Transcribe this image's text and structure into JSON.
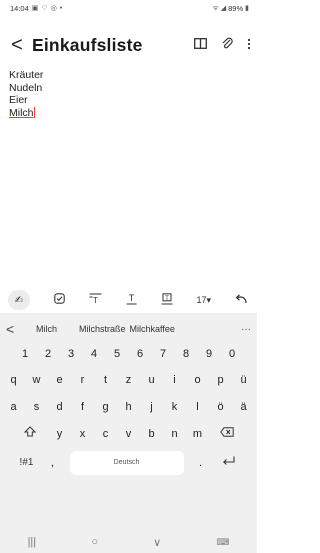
{
  "status": {
    "time": "14:04",
    "left_icons": [
      "gallery-icon",
      "alarm-icon",
      "location-icon",
      "dot-icon"
    ],
    "battery": "89%"
  },
  "app": {
    "back": "<",
    "title": "Einkaufsliste",
    "actions": [
      "book-icon",
      "attach-icon",
      "more-icon"
    ]
  },
  "note": {
    "lines": [
      "Kräuter",
      "Nudeln",
      "Eier",
      "Milch"
    ]
  },
  "toolbar": {
    "font_size": "17▾"
  },
  "suggestions": {
    "items": [
      "Milch",
      "Milchstraße",
      "Milchkaffee"
    ],
    "more": "···"
  },
  "keyboard": {
    "row1": [
      "1",
      "2",
      "3",
      "4",
      "5",
      "6",
      "7",
      "8",
      "9",
      "0"
    ],
    "row2": [
      "q",
      "w",
      "e",
      "r",
      "t",
      "z",
      "u",
      "i",
      "o",
      "p",
      "ü"
    ],
    "row3": [
      "a",
      "s",
      "d",
      "f",
      "g",
      "h",
      "j",
      "k",
      "l",
      "ö",
      "ä"
    ],
    "row4": [
      "y",
      "x",
      "c",
      "v",
      "b",
      "n",
      "m"
    ],
    "symbols_label": "!#1",
    "comma": ",",
    "space_label": "Deutsch",
    "period": "."
  },
  "navbar": {
    "recents": "|||",
    "home": "○",
    "back": "∨",
    "keyboard": "⌨"
  }
}
